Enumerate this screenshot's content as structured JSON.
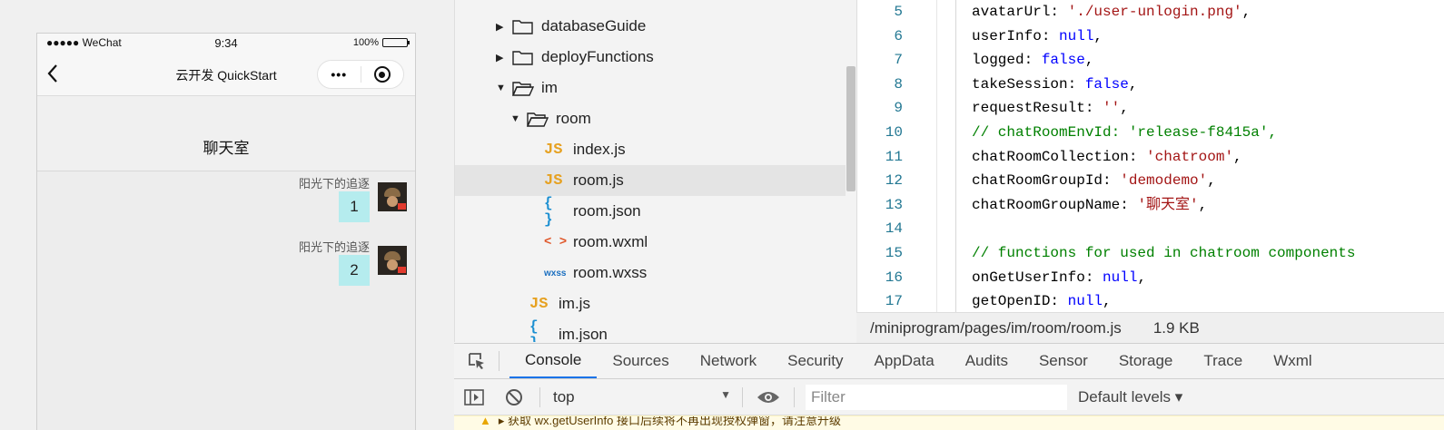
{
  "simulator": {
    "status": {
      "carrier": "●●●●● WeChat",
      "time": "9:34",
      "battery_text": "100%",
      "battery_level": 1.0
    },
    "navbar": {
      "back_icon": "chevron-left-icon",
      "title": "云开发 QuickStart",
      "more_label": "•••"
    },
    "room": {
      "title": "聊天室"
    },
    "messages": [
      {
        "nick": "阳光下的追逐",
        "content": "1"
      },
      {
        "nick": "阳光下的追逐",
        "content": "2"
      }
    ]
  },
  "file_tree": {
    "rows": [
      {
        "label": "databaseGuide",
        "kind": "folder",
        "expanded": false
      },
      {
        "label": "deployFunctions",
        "kind": "folder",
        "expanded": false
      },
      {
        "label": "im",
        "kind": "folder",
        "expanded": true
      },
      {
        "label": "room",
        "kind": "folder",
        "expanded": true
      },
      {
        "label": "index.js",
        "kind": "js",
        "icon_text": "JS"
      },
      {
        "label": "room.js",
        "kind": "js",
        "icon_text": "JS",
        "selected": true
      },
      {
        "label": "room.json",
        "kind": "json",
        "icon_text": "{ }"
      },
      {
        "label": "room.wxml",
        "kind": "wxml",
        "icon_text": "< >"
      },
      {
        "label": "room.wxss",
        "kind": "wxss",
        "icon_text": "wxss"
      },
      {
        "label": "im.js",
        "kind": "js",
        "icon_text": "JS"
      },
      {
        "label": "im.json",
        "kind": "json",
        "icon_text": "{ }"
      }
    ]
  },
  "editor": {
    "lines": [
      {
        "num": "5",
        "key": "avatarUrl: ",
        "val": "'./user-unlogin.png'",
        "type": "s",
        "tail": ","
      },
      {
        "num": "6",
        "key": "userInfo: ",
        "val": "null",
        "type": "n",
        "tail": ","
      },
      {
        "num": "7",
        "key": "logged: ",
        "val": "false",
        "type": "n",
        "tail": ","
      },
      {
        "num": "8",
        "key": "takeSession: ",
        "val": "false",
        "type": "n",
        "tail": ","
      },
      {
        "num": "9",
        "key": "requestResult: ",
        "val": "''",
        "type": "s",
        "tail": ","
      },
      {
        "num": "10",
        "key": "",
        "val": "// chatRoomEnvId: 'release-f8415a',",
        "type": "c",
        "tail": ""
      },
      {
        "num": "11",
        "key": "chatRoomCollection: ",
        "val": "'chatroom'",
        "type": "s",
        "tail": ","
      },
      {
        "num": "12",
        "key": "chatRoomGroupId: ",
        "val": "'demodemo'",
        "type": "s",
        "tail": ","
      },
      {
        "num": "13",
        "key": "chatRoomGroupName: ",
        "val": "'聊天室'",
        "type": "s",
        "tail": ","
      },
      {
        "num": "14",
        "key": "",
        "val": "",
        "type": "k",
        "tail": ""
      },
      {
        "num": "15",
        "key": "",
        "val": "// functions for used in chatroom components",
        "type": "c",
        "tail": ""
      },
      {
        "num": "16",
        "key": "onGetUserInfo: ",
        "val": "null",
        "type": "n",
        "tail": ","
      },
      {
        "num": "17",
        "key": "getOpenID: ",
        "val": "null",
        "type": "n",
        "tail": ","
      }
    ],
    "file_path": "/miniprogram/pages/im/room/room.js",
    "file_size": "1.9 KB"
  },
  "devtools": {
    "tabs": [
      "Console",
      "Sources",
      "Network",
      "Security",
      "AppData",
      "Audits",
      "Sensor",
      "Storage",
      "Trace",
      "Wxml"
    ],
    "active_tab": "Console",
    "context": "top",
    "filter_placeholder": "Filter",
    "levels_label": "Default levels ▾",
    "warning_text": "▸ 获取 wx.getUserInfo 接口后续将不再出现授权弹窗，请注意升级"
  },
  "colors": {
    "accent": "#1a73e8",
    "bubble": "#b5ecee",
    "js": "#e6a121",
    "json": "#1b8fd1",
    "string": "#a31515",
    "keyword": "#0000ff",
    "comment": "#008000"
  }
}
